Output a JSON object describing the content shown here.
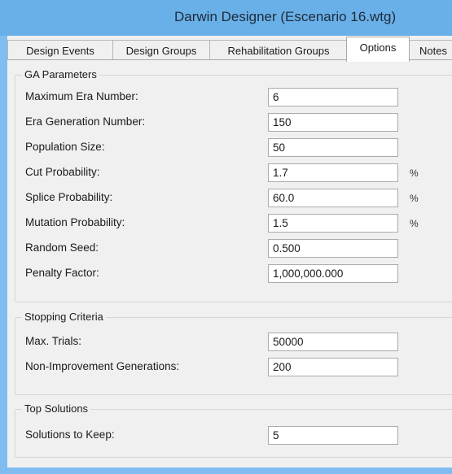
{
  "window": {
    "title": "Darwin Designer (Escenario 16.wtg)"
  },
  "tabs": [
    {
      "label": "Design Events",
      "active": false
    },
    {
      "label": "Design Groups",
      "active": false
    },
    {
      "label": "Rehabilitation Groups",
      "active": false
    },
    {
      "label": "Options",
      "active": true
    },
    {
      "label": "Notes",
      "active": false
    }
  ],
  "ga_parameters": {
    "legend": "GA Parameters",
    "max_era": {
      "label": "Maximum Era Number:",
      "value": "6"
    },
    "era_generation": {
      "label": "Era Generation Number:",
      "value": "150"
    },
    "population_size": {
      "label": "Population Size:",
      "value": "50"
    },
    "cut_probability": {
      "label": "Cut Probability:",
      "value": "1.7",
      "unit": "%"
    },
    "splice_probability": {
      "label": "Splice Probability:",
      "value": "60.0",
      "unit": "%"
    },
    "mutation_probability": {
      "label": "Mutation Probability:",
      "value": "1.5",
      "unit": "%"
    },
    "random_seed": {
      "label": "Random Seed:",
      "value": "0.500"
    },
    "penalty_factor": {
      "label": "Penalty Factor:",
      "value": "1,000,000.000"
    }
  },
  "stopping_criteria": {
    "legend": "Stopping Criteria",
    "max_trials": {
      "label": "Max. Trials:",
      "value": "50000"
    },
    "non_improvement": {
      "label": "Non-Improvement Generations:",
      "value": "200"
    }
  },
  "top_solutions": {
    "legend": "Top Solutions",
    "solutions_to_keep": {
      "label": "Solutions to Keep:",
      "value": "5"
    }
  }
}
